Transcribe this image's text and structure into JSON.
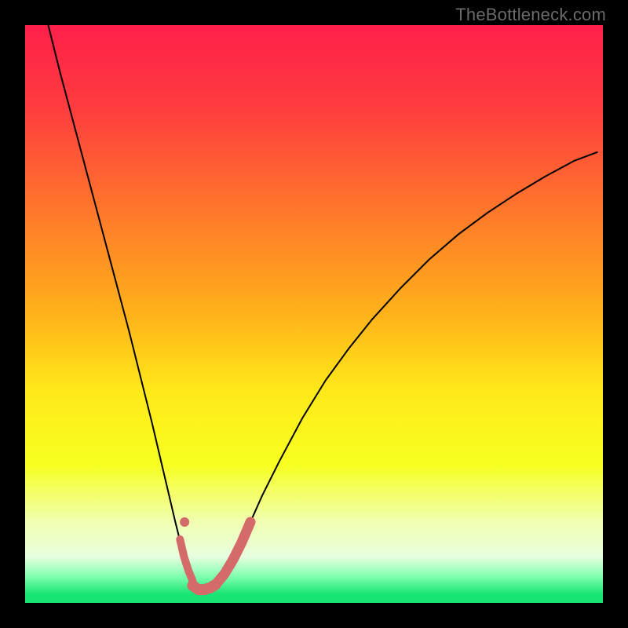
{
  "watermark": "TheBottleneck.com",
  "chart_data": {
    "type": "line",
    "title": "",
    "xlabel": "",
    "ylabel": "",
    "xlim": [
      0,
      100
    ],
    "ylim": [
      0,
      100
    ],
    "gradient_stops": [
      {
        "offset": 0.0,
        "color": "#ff1f4a"
      },
      {
        "offset": 0.15,
        "color": "#ff3e3e"
      },
      {
        "offset": 0.33,
        "color": "#ff7a2a"
      },
      {
        "offset": 0.5,
        "color": "#ffb21a"
      },
      {
        "offset": 0.63,
        "color": "#ffe81a"
      },
      {
        "offset": 0.76,
        "color": "#f7ff20"
      },
      {
        "offset": 0.86,
        "color": "#f0ffb0"
      },
      {
        "offset": 0.92,
        "color": "#e8ffe0"
      },
      {
        "offset": 0.955,
        "color": "#7dffad"
      },
      {
        "offset": 0.985,
        "color": "#18e474"
      },
      {
        "offset": 1.0,
        "color": "#18e474"
      }
    ],
    "series": [
      {
        "name": "bottleneck-curve",
        "color": "#000000",
        "stroke_width": 2,
        "x": [
          4.0,
          6.0,
          8.0,
          10.0,
          12.0,
          14.0,
          16.0,
          18.0,
          20.0,
          22.0,
          24.0,
          26.0,
          28.0,
          29.5,
          30.5,
          31.5,
          33.0,
          35.0,
          37.0,
          39.0,
          41.0,
          44.0,
          48.0,
          52.0,
          56.0,
          60.0,
          65.0,
          70.0,
          75.0,
          80.0,
          85.0,
          90.0,
          95.0,
          99.0
        ],
        "y": [
          100,
          92.0,
          84.5,
          77.0,
          69.5,
          62.0,
          54.5,
          47.0,
          39.0,
          31.0,
          22.5,
          14.0,
          6.0,
          3.0,
          2.3,
          2.3,
          3.0,
          5.5,
          9.5,
          14.0,
          18.5,
          24.5,
          32.0,
          38.5,
          44.0,
          49.0,
          54.5,
          59.5,
          63.8,
          67.5,
          70.8,
          73.8,
          76.5,
          78.0
        ]
      },
      {
        "name": "highlight-left",
        "color": "#d46a6a",
        "stroke_width": 10,
        "x": [
          26.8,
          27.5,
          28.3,
          29.0
        ],
        "y": [
          11.0,
          8.0,
          5.5,
          3.8
        ]
      },
      {
        "name": "highlight-bottom",
        "color": "#d46a6a",
        "stroke_width": 14,
        "x": [
          29.0,
          30.0,
          31.0,
          32.0,
          33.0
        ],
        "y": [
          3.0,
          2.3,
          2.3,
          2.6,
          3.2
        ]
      },
      {
        "name": "highlight-right",
        "color": "#d46a6a",
        "stroke_width": 13,
        "x": [
          33.0,
          34.5,
          36.0,
          37.5,
          39.0
        ],
        "y": [
          3.2,
          5.0,
          7.5,
          10.5,
          14.0
        ]
      }
    ],
    "markers": [
      {
        "name": "highlight-dot",
        "x": 27.6,
        "y": 14.0,
        "r": 6,
        "color": "#d46a6a"
      }
    ]
  }
}
